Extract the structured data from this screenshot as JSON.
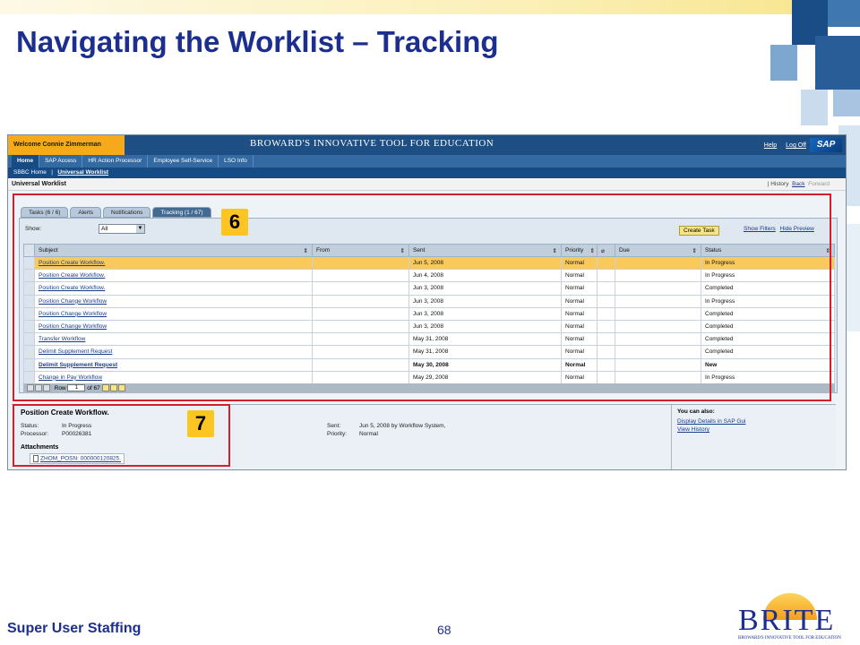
{
  "slide": {
    "title": "Navigating the Worklist – Tracking",
    "footer_left": "Super User Staffing",
    "page_number": "68",
    "logo_text": "BRITE",
    "logo_tagline": "BROWARD'S INNOVATIVE TOOL FOR EDUCATION"
  },
  "portal": {
    "welcome": "Welcome Connie Zimmerman",
    "brand": "BROWARD'S INNOVATIVE TOOL FOR EDUCATION",
    "help": "Help",
    "logoff": "Log Off",
    "sap_logo": "SAP",
    "nav": [
      "Home",
      "SAP Access",
      "HR Action Processor",
      "Employee Self-Service",
      "LSO Info"
    ],
    "subnav_home": "SBBC Home",
    "subnav_sep": "|",
    "subnav_active": "Universal Worklist",
    "page_title": "Universal Worklist",
    "history": "History",
    "back": "Back",
    "forward": "Forward"
  },
  "worklist": {
    "tabs": [
      "Tasks (6 / 6)",
      "Alerts",
      "Notifications",
      "Tracking (1 / 67)"
    ],
    "show_label": "Show:",
    "show_value": "All",
    "create_task": "Create Task",
    "show_filters": "Show Filters",
    "hide_preview": "Hide Preview",
    "columns": [
      "Subject",
      "From",
      "Sent",
      "Priority",
      "Due",
      "Status"
    ],
    "rows": [
      {
        "subject": "Position Create Workflow.",
        "from": "",
        "sent": "Jun 5, 2008",
        "priority": "Normal",
        "due": "",
        "status": "In Progress"
      },
      {
        "subject": "Position Create Workflow.",
        "from": "",
        "sent": "Jun 4, 2008",
        "priority": "Normal",
        "due": "",
        "status": "In Progress"
      },
      {
        "subject": "Position Create Workflow.",
        "from": "",
        "sent": "Jun 3, 2008",
        "priority": "Normal",
        "due": "",
        "status": "Completed"
      },
      {
        "subject": "Position Change Workflow",
        "from": "",
        "sent": "Jun 3, 2008",
        "priority": "Normal",
        "due": "",
        "status": "In Progress"
      },
      {
        "subject": "Position Change Workflow",
        "from": "",
        "sent": "Jun 3, 2008",
        "priority": "Normal",
        "due": "",
        "status": "Completed"
      },
      {
        "subject": "Position Change Workflow",
        "from": "",
        "sent": "Jun 3, 2008",
        "priority": "Normal",
        "due": "",
        "status": "Completed"
      },
      {
        "subject": "Transfer Workflow",
        "from": "",
        "sent": "May 31, 2008",
        "priority": "Normal",
        "due": "",
        "status": "Completed"
      },
      {
        "subject": "Delimit Supplement Request",
        "from": "",
        "sent": "May 31, 2008",
        "priority": "Normal",
        "due": "",
        "status": "Completed"
      },
      {
        "subject": "Delimit Supplement Request",
        "from": "",
        "sent": "May 30, 2008",
        "priority": "Normal",
        "due": "",
        "status": "New"
      },
      {
        "subject": "Change in Pay Workflow",
        "from": "",
        "sent": "May 29, 2008",
        "priority": "Normal",
        "due": "",
        "status": "In Progress"
      }
    ],
    "paging_row_label": "Row",
    "paging_row_value": "1",
    "paging_of": "of 67"
  },
  "preview": {
    "title": "Position Create Workflow.",
    "status_label": "Status:",
    "status_value": "In Progress",
    "processor_label": "Processor:",
    "processor_value": "P00026381",
    "sent_label": "Sent:",
    "sent_value": "Jun 5, 2008 by Workflow System,",
    "priority_label": "Priority:",
    "priority_value": "Normal",
    "attachments_label": "Attachments",
    "attachment_file": "ZHOM_POSN: 000000120825.",
    "can_also_label": "You can also:",
    "actions": [
      "Display Details in SAP Gui",
      "View History"
    ]
  },
  "callouts": [
    "6",
    "7"
  ],
  "colors": {
    "title_blue": "#1c2f8f",
    "callout_yellow": "#fcc521",
    "highlight_red": "#d41f2a",
    "selected_row": "#f9c95c"
  }
}
